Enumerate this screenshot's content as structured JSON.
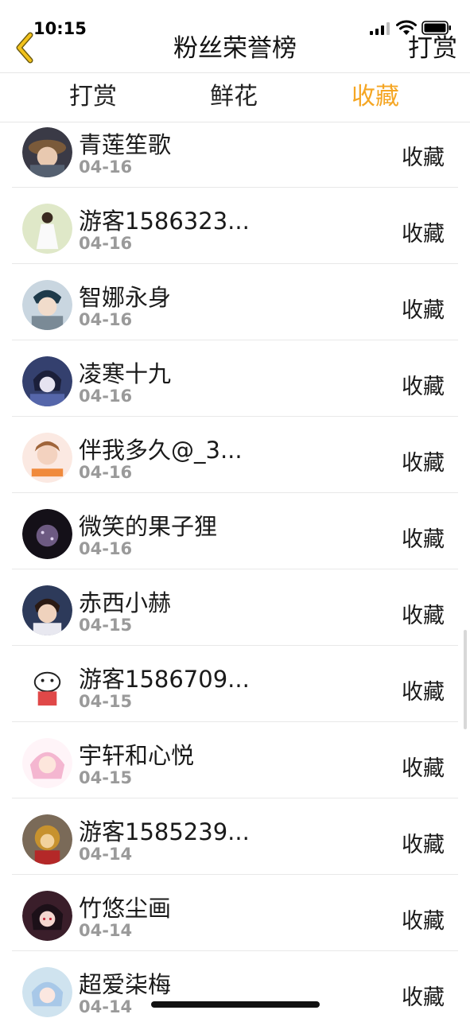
{
  "status_bar": {
    "time": "10:15"
  },
  "nav": {
    "title": "粉丝荣誉榜",
    "right_button": "打赏"
  },
  "tabs": [
    {
      "label": "打赏",
      "active": false
    },
    {
      "label": "鲜花",
      "active": false
    },
    {
      "label": "收藏",
      "active": true
    }
  ],
  "colors": {
    "accent": "#f5a623",
    "back_icon_fill": "#f2c21b"
  },
  "fans": [
    {
      "name": "青莲笙歌",
      "date": "04-16",
      "action": "收藏",
      "avatar_icon": "avatar-girl-hat"
    },
    {
      "name": "游客1586323...",
      "date": "04-16",
      "action": "收藏",
      "avatar_icon": "avatar-girl-white-dress"
    },
    {
      "name": "智娜永身",
      "date": "04-16",
      "action": "收藏",
      "avatar_icon": "avatar-anime-boy"
    },
    {
      "name": "凌寒十九",
      "date": "04-16",
      "action": "收藏",
      "avatar_icon": "avatar-anime-blue"
    },
    {
      "name": "伴我多久@_3...",
      "date": "04-16",
      "action": "收藏",
      "avatar_icon": "avatar-girl-cute"
    },
    {
      "name": "微笑的果子狸",
      "date": "04-16",
      "action": "收藏",
      "avatar_icon": "avatar-dark-sparkle"
    },
    {
      "name": "赤西小赫",
      "date": "04-15",
      "action": "收藏",
      "avatar_icon": "avatar-boy-photo"
    },
    {
      "name": "游客1586709...",
      "date": "04-15",
      "action": "收藏",
      "avatar_icon": "avatar-cat-cartoon"
    },
    {
      "name": "宇轩和心悦",
      "date": "04-15",
      "action": "收藏",
      "avatar_icon": "avatar-pink-anime-girl"
    },
    {
      "name": "游客1585239...",
      "date": "04-14",
      "action": "收藏",
      "avatar_icon": "avatar-monkey-toy"
    },
    {
      "name": "竹悠尘画",
      "date": "04-14",
      "action": "收藏",
      "avatar_icon": "avatar-anime-dark"
    },
    {
      "name": "超爱柒梅",
      "date": "04-14",
      "action": "收藏",
      "avatar_icon": "avatar-anime-pastel"
    }
  ]
}
